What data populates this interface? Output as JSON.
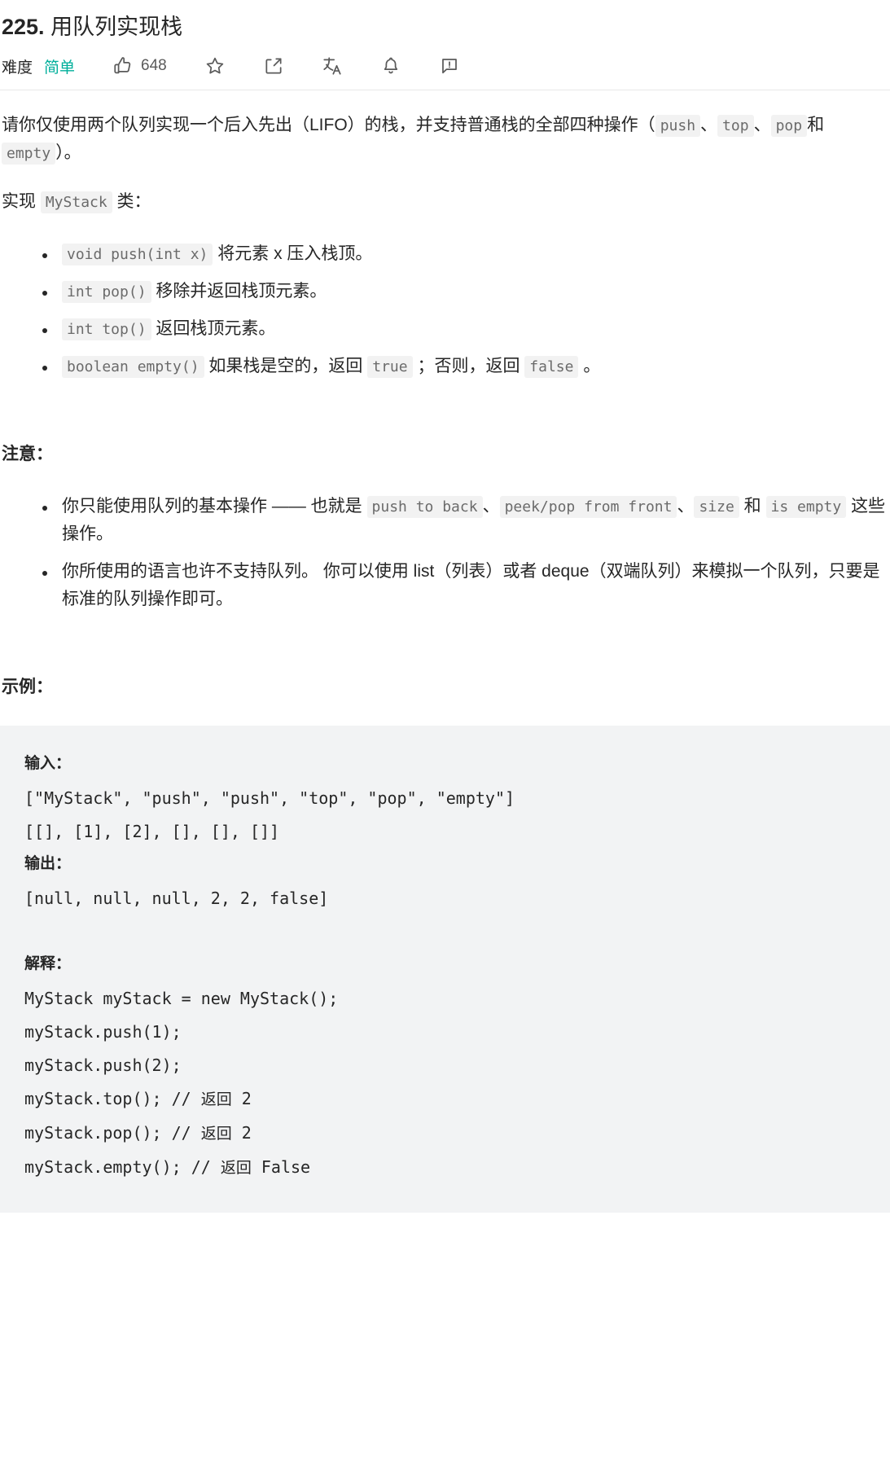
{
  "header": {
    "number": "225.",
    "title": "用队列实现栈",
    "difficulty_label": "难度",
    "difficulty_value": "简单",
    "difficulty_color": "#00af9b",
    "like_count": "648",
    "icons": {
      "like": "thumbs-up-icon",
      "favorite": "star-icon",
      "share": "share-icon",
      "translate": "translate-icon",
      "notify": "bell-icon",
      "report": "comment-report-icon"
    }
  },
  "body": {
    "p1_a": "请你仅使用两个队列实现一个后入先出（LIFO）的栈，并支持普通栈的全部四种操作（",
    "p1_code1": "push",
    "p1_sep1": "、",
    "p1_code2": "top",
    "p1_sep2": "、",
    "p1_code3": "pop",
    "p1_mid": "和",
    "p1_code4": "empty",
    "p1_end": "）。",
    "p2_a": "实现",
    "p2_code": "MyStack",
    "p2_b": "类：",
    "methods": [
      {
        "code": "void push(int x)",
        "text": "将元素 x 压入栈顶。"
      },
      {
        "code": "int pop()",
        "text": "移除并返回栈顶元素。"
      },
      {
        "code": "int top()",
        "text": "返回栈顶元素。"
      }
    ],
    "method4": {
      "code": "boolean empty()",
      "t1": "如果栈是空的，返回",
      "c1": "true",
      "t2": "；否则，返回",
      "c2": "false",
      "t3": "。"
    },
    "note_head": "注意：",
    "note1": {
      "t1": "你只能使用队列的基本操作 —— 也就是",
      "c1": "push to back",
      "t2": "、",
      "c2": "peek/pop from front",
      "t3": "、",
      "c3": "size",
      "t4": "和",
      "c4": "is empty",
      "t5": "这些操作。"
    },
    "note2": "你所使用的语言也许不支持队列。 你可以使用 list（列表）或者 deque（双端队列）来模拟一个队列，只要是标准的队列操作即可。",
    "example_head": "示例："
  },
  "code_block": {
    "input_label": "输入：",
    "input_line1": "[\"MyStack\", \"push\", \"push\", \"top\", \"pop\", \"empty\"]",
    "input_line2": "[[], [1], [2], [], [], []]",
    "output_label": "输出：",
    "output_line": "[null, null, null, 2, 2, false]",
    "explain_label": "解释：",
    "explain_lines": [
      "MyStack myStack = new MyStack();",
      "myStack.push(1);",
      "myStack.push(2);"
    ],
    "explain_calls": [
      {
        "call": "myStack.top(); // ",
        "comment": "返回",
        "value": " 2"
      },
      {
        "call": "myStack.pop(); // ",
        "comment": "返回",
        "value": " 2"
      },
      {
        "call": "myStack.empty(); // ",
        "comment": "返回",
        "value": " False"
      }
    ]
  }
}
